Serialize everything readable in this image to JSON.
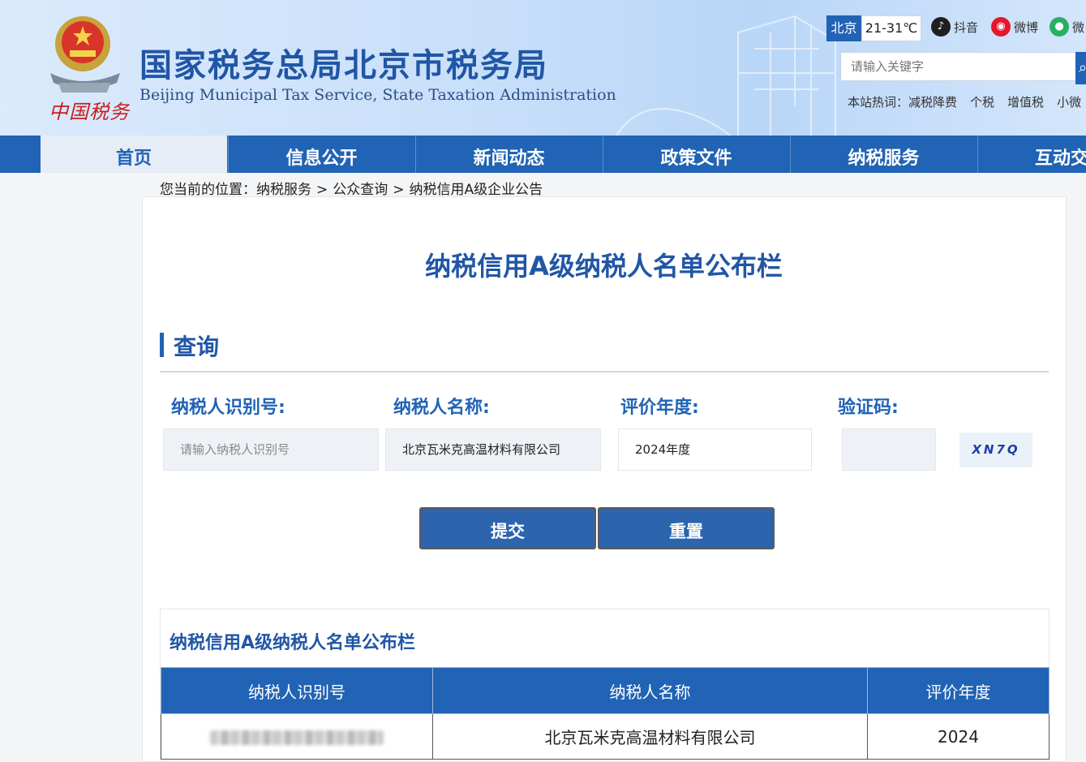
{
  "header": {
    "title_cn": "国家税务总局北京市税务局",
    "title_en": "Beijing Municipal Tax Service, State Taxation Administration",
    "emblem_caption": "中国税务",
    "weather": {
      "city": "北京",
      "temp": "21-31℃"
    },
    "social": [
      {
        "icon": "douyin-icon",
        "label": "抖音",
        "color": "#1f1f1f"
      },
      {
        "icon": "weibo-icon",
        "label": "微博",
        "color": "#e6162d"
      },
      {
        "icon": "wechat-icon",
        "label": "微",
        "color": "#2aae67"
      }
    ],
    "search": {
      "placeholder": "请输入关键字"
    },
    "hotwords": {
      "label": "本站热词：",
      "items": [
        "减税降费",
        "个税",
        "增值税",
        "小微"
      ]
    }
  },
  "nav": {
    "items": [
      {
        "label": "首页",
        "active": true
      },
      {
        "label": "信息公开",
        "active": false
      },
      {
        "label": "新闻动态",
        "active": false
      },
      {
        "label": "政策文件",
        "active": false
      },
      {
        "label": "纳税服务",
        "active": false
      },
      {
        "label": "互动交流",
        "active": false
      }
    ]
  },
  "breadcrumb": {
    "prefix": "您当前的位置：",
    "items": [
      "纳税服务",
      "公众查询",
      "纳税信用A级企业公告"
    ],
    "separator": ">"
  },
  "main": {
    "page_title": "纳税信用A级纳税人名单公布栏",
    "section_title": "查询",
    "form": {
      "taxpayer_id": {
        "label": "纳税人识别号:",
        "value": "",
        "placeholder": "请输入纳税人识别号"
      },
      "taxpayer_name": {
        "label": "纳税人名称:",
        "value": "北京瓦米克高温材料有限公司"
      },
      "year": {
        "label": "评价年度:",
        "value": "2024年度"
      },
      "captcha": {
        "label": "验证码:",
        "value": "",
        "image_text": "XN7Q"
      }
    },
    "buttons": {
      "submit": "提交",
      "reset": "重置"
    },
    "result": {
      "title": "纳税信用A级纳税人名单公布栏",
      "headers": [
        "纳税人识别号",
        "纳税人名称",
        "评价年度"
      ],
      "rows": [
        {
          "id": "",
          "name": "北京瓦米克高温材料有限公司",
          "year": "2024"
        }
      ]
    }
  },
  "colors": {
    "brand_blue": "#2163b5",
    "title_blue": "#2156a5"
  }
}
